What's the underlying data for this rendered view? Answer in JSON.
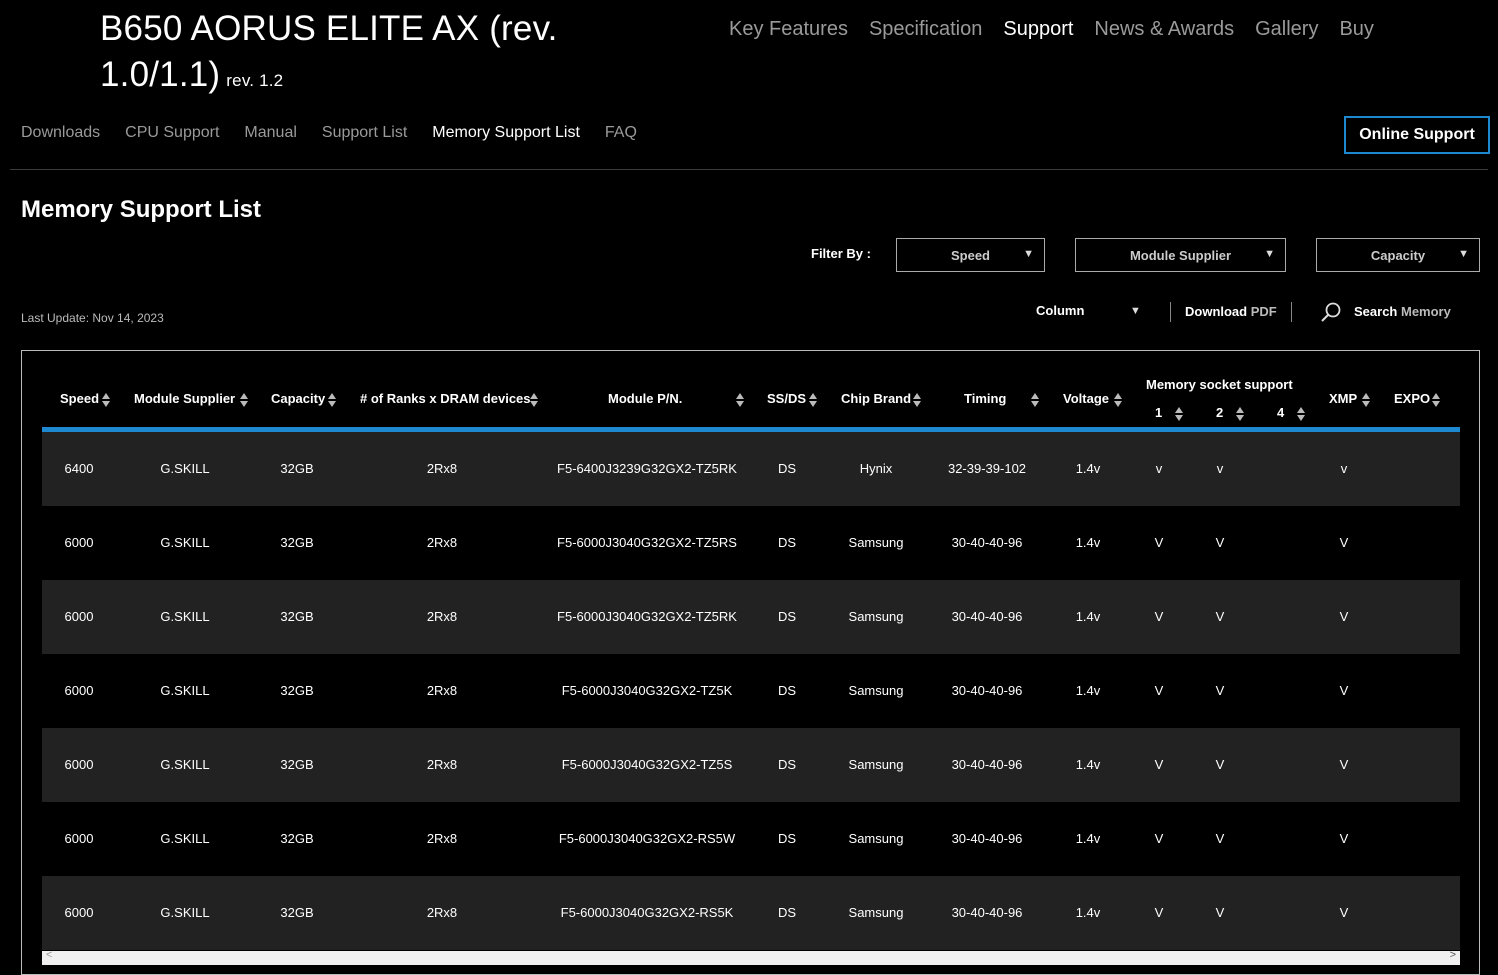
{
  "product": {
    "title": "B650 AORUS ELITE AX (rev. 1.0/1.1)",
    "rev_small": "rev. 1.2"
  },
  "top_nav": [
    "Key Features",
    "Specification",
    "Support",
    "News & Awards",
    "Gallery",
    "Buy"
  ],
  "top_nav_active": "Support",
  "sub_nav": [
    "Downloads",
    "CPU Support",
    "Manual",
    "Support List",
    "Memory Support List",
    "FAQ"
  ],
  "sub_nav_active": "Memory Support List",
  "online_support": "Online Support",
  "page_title": "Memory Support List",
  "filters": {
    "label": "Filter By :",
    "speed": "Speed",
    "supplier": "Module Supplier",
    "capacity": "Capacity"
  },
  "last_update": "Last Update: Nov 14, 2023",
  "toolbar": {
    "column": "Column",
    "download": "Download",
    "pdf": "PDF",
    "search": "Search",
    "memory": "Memory"
  },
  "table": {
    "headers": {
      "speed": "Speed",
      "supplier": "Module Supplier",
      "capacity": "Capacity",
      "ranks": "# of Ranks x DRAM devices",
      "pn": "Module P/N.",
      "ssds": "SS/DS",
      "chip": "Chip Brand",
      "timing": "Timing",
      "voltage": "Voltage",
      "socket": "Memory socket support",
      "s1": "1",
      "s2": "2",
      "s4": "4",
      "xmp": "XMP",
      "expo": "EXPO"
    },
    "rows": [
      [
        "6400",
        "G.SKILL",
        "32GB",
        "2Rx8",
        "F5-6400J3239G32GX2-TZ5RK",
        "DS",
        "Hynix",
        "32-39-39-102",
        "1.4v",
        "v",
        "v",
        "",
        "v",
        ""
      ],
      [
        "6000",
        "G.SKILL",
        "32GB",
        "2Rx8",
        "F5-6000J3040G32GX2-TZ5RS",
        "DS",
        "Samsung",
        "30-40-40-96",
        "1.4v",
        "V",
        "V",
        "",
        "V",
        ""
      ],
      [
        "6000",
        "G.SKILL",
        "32GB",
        "2Rx8",
        "F5-6000J3040G32GX2-TZ5RK",
        "DS",
        "Samsung",
        "30-40-40-96",
        "1.4v",
        "V",
        "V",
        "",
        "V",
        ""
      ],
      [
        "6000",
        "G.SKILL",
        "32GB",
        "2Rx8",
        "F5-6000J3040G32GX2-TZ5K",
        "DS",
        "Samsung",
        "30-40-40-96",
        "1.4v",
        "V",
        "V",
        "",
        "V",
        ""
      ],
      [
        "6000",
        "G.SKILL",
        "32GB",
        "2Rx8",
        "F5-6000J3040G32GX2-TZ5S",
        "DS",
        "Samsung",
        "30-40-40-96",
        "1.4v",
        "V",
        "V",
        "",
        "V",
        ""
      ],
      [
        "6000",
        "G.SKILL",
        "32GB",
        "2Rx8",
        "F5-6000J3040G32GX2-RS5W",
        "DS",
        "Samsung",
        "30-40-40-96",
        "1.4v",
        "V",
        "V",
        "",
        "V",
        ""
      ],
      [
        "6000",
        "G.SKILL",
        "32GB",
        "2Rx8",
        "F5-6000J3040G32GX2-RS5K",
        "DS",
        "Samsung",
        "30-40-40-96",
        "1.4v",
        "V",
        "V",
        "",
        "V",
        ""
      ]
    ]
  },
  "colors": {
    "accent": "#1e88d0",
    "row_alt": "#222222"
  },
  "icons": {
    "search": "search-icon",
    "sort": "sort-arrows-icon",
    "dropdown": "triangle-down-icon"
  }
}
